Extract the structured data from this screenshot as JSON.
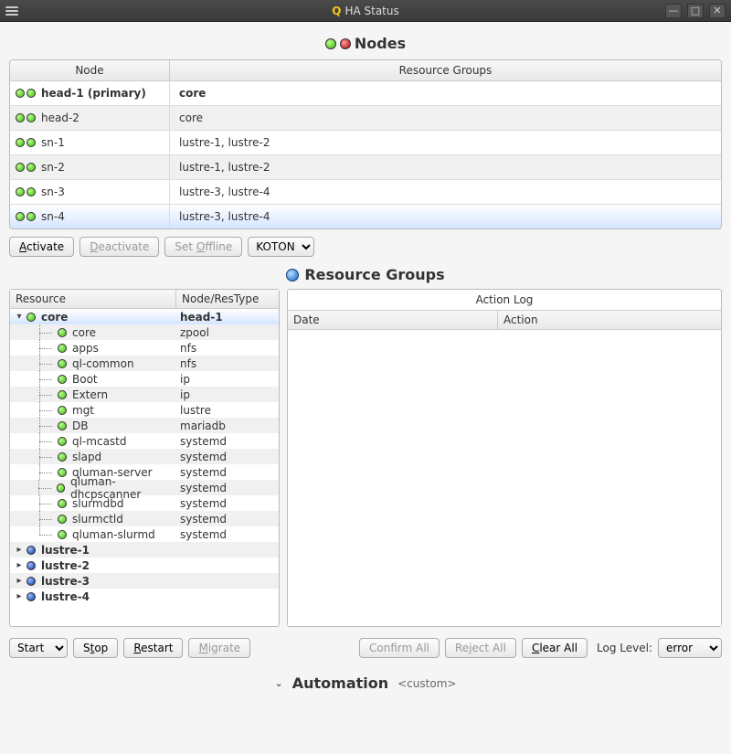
{
  "window": {
    "title": "HA Status"
  },
  "sections": {
    "nodes_title": "Nodes",
    "rg_title": "Resource Groups",
    "action_log_title": "Action Log",
    "automation_title": "Automation",
    "automation_custom": "<custom>"
  },
  "nodes": {
    "headers": {
      "node": "Node",
      "rg": "Resource Groups"
    },
    "rows": [
      {
        "name": "head-1 (primary)",
        "rg": "core",
        "primary": true
      },
      {
        "name": "head-2",
        "rg": "core"
      },
      {
        "name": "sn-1",
        "rg": "lustre-1, lustre-2"
      },
      {
        "name": "sn-2",
        "rg": "lustre-1, lustre-2"
      },
      {
        "name": "sn-3",
        "rg": "lustre-3, lustre-4"
      },
      {
        "name": "sn-4",
        "rg": "lustre-3, lustre-4",
        "selected": true
      }
    ]
  },
  "node_buttons": {
    "activate": "Activate",
    "deactivate": "Deactivate",
    "set_offline": "Set Offline",
    "koton": "KOTON"
  },
  "tree": {
    "headers": {
      "resource": "Resource",
      "node_restype": "Node/ResType"
    },
    "groups": [
      {
        "name": "core",
        "node": "head-1",
        "expanded": true,
        "selected": true,
        "children": [
          {
            "name": "core",
            "type": "zpool"
          },
          {
            "name": "apps",
            "type": "nfs"
          },
          {
            "name": "ql-common",
            "type": "nfs"
          },
          {
            "name": "Boot",
            "type": "ip"
          },
          {
            "name": "Extern",
            "type": "ip"
          },
          {
            "name": "mgt",
            "type": "lustre"
          },
          {
            "name": "DB",
            "type": "mariadb"
          },
          {
            "name": "ql-mcastd",
            "type": "systemd"
          },
          {
            "name": "slapd",
            "type": "systemd"
          },
          {
            "name": "qluman-server",
            "type": "systemd"
          },
          {
            "name": "qluman-dhcpscanner",
            "type": "systemd"
          },
          {
            "name": "slurmdbd",
            "type": "systemd"
          },
          {
            "name": "slurmctld",
            "type": "systemd"
          },
          {
            "name": "qluman-slurmd",
            "type": "systemd"
          }
        ]
      },
      {
        "name": "lustre-1",
        "expanded": false
      },
      {
        "name": "lustre-2",
        "expanded": false
      },
      {
        "name": "lustre-3",
        "expanded": false
      },
      {
        "name": "lustre-4",
        "expanded": false
      }
    ]
  },
  "log": {
    "headers": {
      "date": "Date",
      "action": "Action"
    }
  },
  "rg_buttons": {
    "start": "Start",
    "stop": "Stop",
    "restart": "Restart",
    "migrate": "Migrate",
    "confirm_all": "Confirm All",
    "reject_all": "Reject All",
    "clear_all": "Clear All",
    "log_level_label": "Log Level:",
    "log_level": "error"
  }
}
